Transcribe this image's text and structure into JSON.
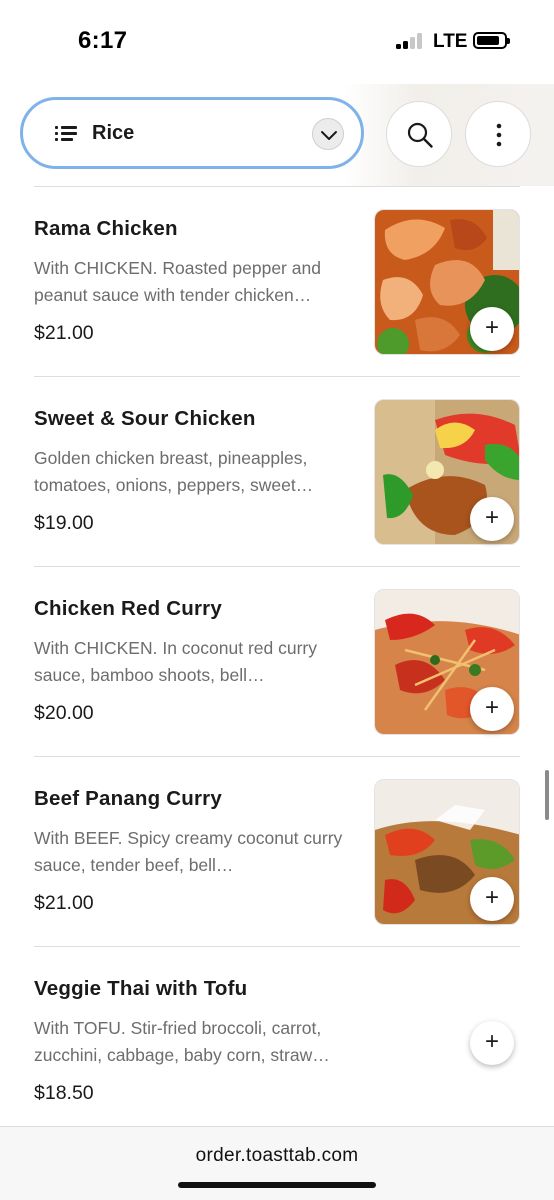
{
  "status_bar": {
    "time": "6:17",
    "network": "LTE",
    "signal_bars_filled": 2,
    "signal_bars_total": 4
  },
  "header": {
    "category": {
      "label": "Rice",
      "icon": "list-icon",
      "expand_icon": "chevron-down-icon"
    },
    "search_icon": "search-icon",
    "more_icon": "more-vertical-icon",
    "accent_color": "#7fb3e8"
  },
  "menu_items": [
    {
      "name": "Rama Chicken",
      "description": "With CHICKEN. Roasted pepper and peanut sauce with tender chicken…",
      "price": "$21.00",
      "has_photo": true,
      "add_label": "+"
    },
    {
      "name": "Sweet & Sour Chicken",
      "description": "Golden chicken breast, pineapples, tomatoes, onions, peppers, sweet…",
      "price": "$19.00",
      "has_photo": true,
      "add_label": "+"
    },
    {
      "name": "Chicken Red Curry",
      "description": "With CHICKEN. In coconut red curry sauce, bamboo shoots, bell…",
      "price": "$20.00",
      "has_photo": true,
      "add_label": "+"
    },
    {
      "name": "Beef Panang Curry",
      "description": "With BEEF. Spicy creamy coconut curry sauce, tender beef, bell…",
      "price": "$21.00",
      "has_photo": true,
      "add_label": "+"
    },
    {
      "name": "Veggie Thai with Tofu",
      "description": "With TOFU. Stir-fried broccoli, carrot, zucchini, cabbage, baby corn, straw…",
      "price": "$18.50",
      "has_photo": false,
      "add_label": "+"
    }
  ],
  "browser": {
    "url": "order.toasttab.com"
  }
}
